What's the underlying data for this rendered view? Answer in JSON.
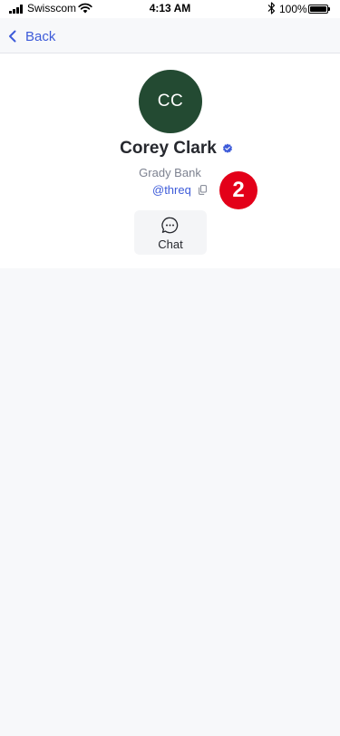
{
  "status_bar": {
    "carrier": "Swisscom",
    "time": "4:13 AM",
    "battery_percent": "100%"
  },
  "nav": {
    "back_label": "Back"
  },
  "profile": {
    "avatar_initials": "CC",
    "avatar_color": "#234a32",
    "name": "Corey Clark",
    "verified": true,
    "company": "Grady Bank",
    "handle": "@threq",
    "badge_count": "2",
    "accent_color": "#3d5bd9",
    "badge_color": "#e30019"
  },
  "actions": {
    "chat_label": "Chat",
    "chat_icon": "chat-bubble-icon"
  }
}
